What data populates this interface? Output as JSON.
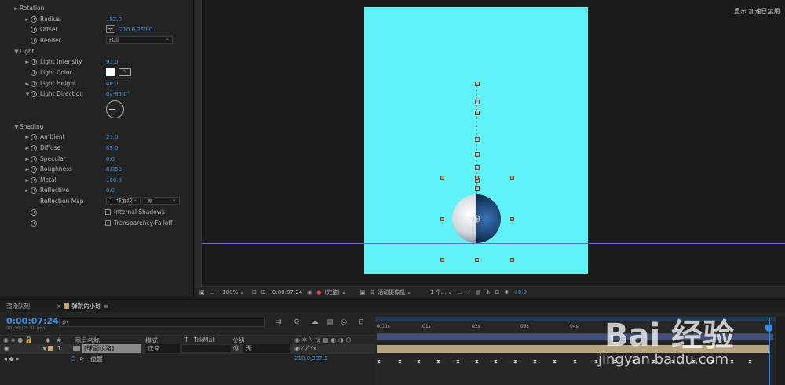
{
  "effect_controls": {
    "rows": [
      {
        "label": "Rotation",
        "value": "",
        "indent": 1,
        "twirl": "►",
        "stopwatch": false
      },
      {
        "label": "Radius",
        "value": "152.0",
        "indent": 2,
        "twirl": "►",
        "stopwatch": true
      },
      {
        "label": "Offset",
        "value": "210.0,250.0",
        "indent": 2,
        "twirl": "",
        "stopwatch": true,
        "crosshair": true
      },
      {
        "label": "Render",
        "value": "",
        "indent": 2,
        "twirl": "",
        "stopwatch": true,
        "dropdown": "Full"
      },
      {
        "label": "Light",
        "value": "",
        "indent": 1,
        "twirl": "▼",
        "stopwatch": false
      },
      {
        "label": "Light Intensity",
        "value": "92.0",
        "indent": 2,
        "twirl": "►",
        "stopwatch": true
      },
      {
        "label": "Light Color",
        "value": "",
        "indent": 2,
        "twirl": "",
        "stopwatch": true,
        "color": true
      },
      {
        "label": "Light Height",
        "value": "40.0",
        "indent": 2,
        "twirl": "►",
        "stopwatch": true
      },
      {
        "label": "Light Direction",
        "value": "0x-85.0°",
        "indent": 2,
        "twirl": "▼",
        "stopwatch": true
      },
      {
        "label": "Shading",
        "value": "",
        "indent": 1,
        "twirl": "▼",
        "stopwatch": false
      },
      {
        "label": "Ambient",
        "value": "21.0",
        "indent": 2,
        "twirl": "►",
        "stopwatch": true
      },
      {
        "label": "Diffuse",
        "value": "85.0",
        "indent": 2,
        "twirl": "►",
        "stopwatch": true
      },
      {
        "label": "Specular",
        "value": "0.0",
        "indent": 2,
        "twirl": "►",
        "stopwatch": true
      },
      {
        "label": "Roughness",
        "value": "0.050",
        "indent": 2,
        "twirl": "►",
        "stopwatch": true
      },
      {
        "label": "Metal",
        "value": "100.0",
        "indent": 2,
        "twirl": "►",
        "stopwatch": true
      },
      {
        "label": "Reflective",
        "value": "0.0",
        "indent": 2,
        "twirl": "►",
        "stopwatch": true
      },
      {
        "label": "Reflection Map",
        "value": "",
        "indent": 2,
        "twirl": "",
        "stopwatch": false,
        "dropdown": "1. 球面纹",
        "dropdown2": "源"
      },
      {
        "label": "",
        "value": "",
        "indent": 2,
        "twirl": "",
        "stopwatch": true,
        "checkbox": "Internal Shadows"
      },
      {
        "label": "",
        "value": "",
        "indent": 2,
        "twirl": "",
        "stopwatch": true,
        "checkbox": "Transparency Falloff"
      }
    ]
  },
  "viewer": {
    "top_right_label": "显示 加速已禁用",
    "zoom": "100%",
    "timecode": "0:00:07:24",
    "quality": "(完整)",
    "camera": "活动摄像机",
    "views": "1 个...",
    "exposure": "+0.0"
  },
  "timeline": {
    "tabs": [
      "渲染队列",
      "弹跳的小球"
    ],
    "timecode": "0:00:07:24",
    "fps": "00199 (25.00 fps)",
    "search_placeholder": "ρ▾",
    "columns": [
      "图层名称",
      "模式",
      "T",
      "TrkMat",
      "父级"
    ],
    "layer": {
      "index": "1",
      "name": "[球面纹路]",
      "mode": "正常",
      "parent": "无"
    },
    "property": {
      "name": "位置",
      "value": "210.0,397.1"
    },
    "ruler_ticks": [
      "0:00s",
      "01s",
      "02s",
      "03s",
      "04s"
    ]
  },
  "watermark": {
    "text": "jingyan.baidu.com",
    "logo": "Bai 经验"
  },
  "colors": {
    "canvas": "#5ff2f7",
    "accent": "#3d8fe0",
    "playhead": "#2d8ceb"
  }
}
